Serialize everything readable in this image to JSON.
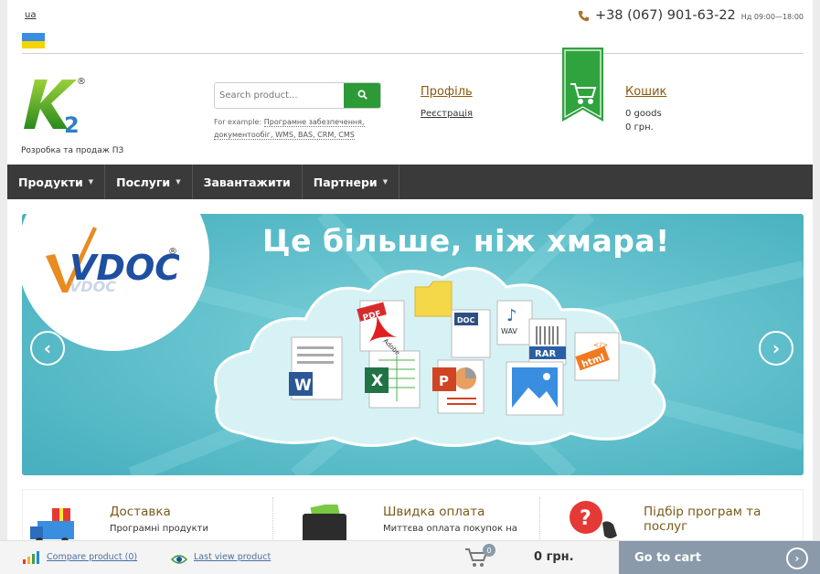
{
  "top": {
    "lang": "ua",
    "phone": "+38 (067) 901-63-22",
    "hours": "Нд 09:00—18:00"
  },
  "header": {
    "tagline": "Розробка та продаж ПЗ",
    "logo_reg": "®",
    "search_placeholder": "Search product...",
    "example_label": "For example: ",
    "example_link1": "Програмне забезпечення,",
    "example_link2": "документообіг, WMS, BAS, CRM, CMS",
    "profile": "Профіль",
    "register": "Реєстрація",
    "cart": "Кошик",
    "cart_goods": "0 goods",
    "cart_sum": "0 грн."
  },
  "nav": {
    "items": [
      {
        "label": "Продукти",
        "caret": "▼"
      },
      {
        "label": "Послуги",
        "caret": "▼"
      },
      {
        "label": "Завантажити",
        "caret": ""
      },
      {
        "label": "Партнери",
        "caret": "▼"
      }
    ]
  },
  "banner": {
    "title": "Це більше, ніж хмара!",
    "brand": "VDOC",
    "brand_reg": "®",
    "labels": {
      "pdf": "PDF",
      "doc": "DOC",
      "wav": "WAV",
      "rar": "RAR",
      "html": "html",
      "adobe": "Adobe"
    }
  },
  "features": [
    {
      "title": "Доставка",
      "text": "Програмні продукти"
    },
    {
      "title": "Швидка оплата",
      "text": "Миттєва оплата покупок на"
    },
    {
      "title": "Підбір програм та послуг",
      "text": ""
    }
  ],
  "bottom": {
    "compare": "Compare product (0)",
    "lastview": "Last view product",
    "badge": "0",
    "sum": "0 грн.",
    "gocart": "Go to cart"
  },
  "colors": {
    "green": "#2d9a38",
    "nav_bg": "#3a3a3a",
    "link_brown": "#8b5a10",
    "banner_bg": "#62c3cf",
    "gocart_bg": "#8a9aab"
  }
}
